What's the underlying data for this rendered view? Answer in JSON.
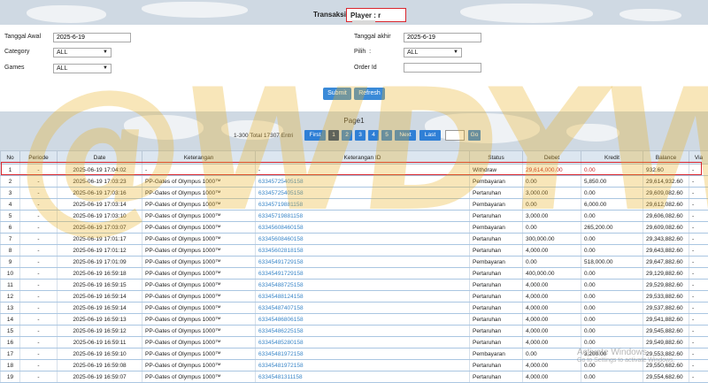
{
  "header": {
    "title": "Transaksi",
    "player_label": "Player : r"
  },
  "form": {
    "tanggal_awal_label": "Tanggal Awal",
    "tanggal_awal_value": "2025-6-19",
    "tanggal_akhir_label": "Tanggal akhir",
    "tanggal_akhir_value": "2025-6-19",
    "category_label": "Category",
    "category_value": "ALL",
    "pilih_label": "Pilih",
    "pilih_colon": ":",
    "pilih_value": "ALL",
    "games_label": "Games",
    "games_value": "ALL",
    "order_id_label": "Order Id",
    "order_id_value": "",
    "submit_label": "Submit",
    "refresh_label": "Refresh"
  },
  "pager": {
    "page_title": "Page1",
    "info": "1-300 Total 17307 Entri",
    "first_label": "First",
    "pages": [
      "1",
      "2",
      "3",
      "4",
      "5"
    ],
    "active_page": "1",
    "next_label": "Next",
    "last_label": "Last",
    "go_label": "Go"
  },
  "table": {
    "columns": [
      "No",
      "Periode",
      "Date",
      "Keterangan",
      "Keterangan ID",
      "Status",
      "Debet",
      "Kredit",
      "Balance",
      "Via"
    ],
    "rows": [
      [
        "1",
        "-",
        "2025-06-19 17:04:02",
        "-",
        "-",
        "Withdraw",
        "29,614,000.00",
        "0.00",
        "932.60",
        "-"
      ],
      [
        "2",
        "-",
        "2025-06-19 17:03:23",
        "PP-Gates of Olympus 1000™",
        "63345725405158",
        "Pembayaran",
        "0.00",
        "5,850.00",
        "29,614,932.60",
        "-"
      ],
      [
        "3",
        "-",
        "2025-06-19 17:03:16",
        "PP-Gates of Olympus 1000™",
        "63345725405158",
        "Pertaruhan",
        "3,000.00",
        "0.00",
        "29,609,082.60",
        "-"
      ],
      [
        "4",
        "-",
        "2025-06-19 17:03:14",
        "PP-Gates of Olympus 1000™",
        "63345719881158",
        "Pembayaran",
        "0.00",
        "6,000.00",
        "29,612,082.60",
        "-"
      ],
      [
        "5",
        "-",
        "2025-06-19 17:03:10",
        "PP-Gates of Olympus 1000™",
        "63345719881158",
        "Pertaruhan",
        "3,000.00",
        "0.00",
        "29,606,082.60",
        "-"
      ],
      [
        "6",
        "-",
        "2025-06-19 17:03:07",
        "PP-Gates of Olympus 1000™",
        "63345608460158",
        "Pembayaran",
        "0.00",
        "265,200.00",
        "29,609,082.60",
        "-"
      ],
      [
        "7",
        "-",
        "2025-06-19 17:01:17",
        "PP-Gates of Olympus 1000™",
        "63345608460158",
        "Pertaruhan",
        "300,000.00",
        "0.00",
        "29,343,882.60",
        "-"
      ],
      [
        "8",
        "-",
        "2025-06-19 17:01:12",
        "PP-Gates of Olympus 1000™",
        "63345602818158",
        "Pertaruhan",
        "4,000.00",
        "0.00",
        "29,643,882.60",
        "-"
      ],
      [
        "9",
        "-",
        "2025-06-19 17:01:09",
        "PP-Gates of Olympus 1000™",
        "63345491729158",
        "Pembayaran",
        "0.00",
        "518,000.00",
        "29,647,882.60",
        "-"
      ],
      [
        "10",
        "-",
        "2025-06-19 16:59:18",
        "PP-Gates of Olympus 1000™",
        "63345491729158",
        "Pertaruhan",
        "400,000.00",
        "0.00",
        "29,129,882.60",
        "-"
      ],
      [
        "11",
        "-",
        "2025-06-19 16:59:15",
        "PP-Gates of Olympus 1000™",
        "63345488725158",
        "Pertaruhan",
        "4,000.00",
        "0.00",
        "29,529,882.60",
        "-"
      ],
      [
        "12",
        "-",
        "2025-06-19 16:59:14",
        "PP-Gates of Olympus 1000™",
        "63345488124158",
        "Pertaruhan",
        "4,000.00",
        "0.00",
        "29,533,882.60",
        "-"
      ],
      [
        "13",
        "-",
        "2025-06-19 16:59:14",
        "PP-Gates of Olympus 1000™",
        "63345487407158",
        "Pertaruhan",
        "4,000.00",
        "0.00",
        "29,537,882.60",
        "-"
      ],
      [
        "14",
        "-",
        "2025-06-19 16:59:13",
        "PP-Gates of Olympus 1000™",
        "63345486806158",
        "Pertaruhan",
        "4,000.00",
        "0.00",
        "29,541,882.60",
        "-"
      ],
      [
        "15",
        "-",
        "2025-06-19 16:59:12",
        "PP-Gates of Olympus 1000™",
        "63345486225158",
        "Pertaruhan",
        "4,000.00",
        "0.00",
        "29,545,882.60",
        "-"
      ],
      [
        "16",
        "-",
        "2025-06-19 16:59:11",
        "PP-Gates of Olympus 1000™",
        "63345485280158",
        "Pertaruhan",
        "4,000.00",
        "0.00",
        "29,549,882.60",
        "-"
      ],
      [
        "17",
        "-",
        "2025-06-19 16:59:10",
        "PP-Gates of Olympus 1000™",
        "63345481972158",
        "Pembayaran",
        "0.00",
        "3,200.00",
        "29,553,882.60",
        "-"
      ],
      [
        "18",
        "-",
        "2025-06-19 16:59:08",
        "PP-Gates of Olympus 1000™",
        "63345481972158",
        "Pertaruhan",
        "4,000.00",
        "0.00",
        "29,550,682.60",
        "-"
      ],
      [
        "19",
        "-",
        "2025-06-19 16:59:07",
        "PP-Gates of Olympus 1000™",
        "63345481311158",
        "Pertaruhan",
        "4,000.00",
        "0.00",
        "29,554,682.60",
        "-"
      ]
    ]
  },
  "overlay": {
    "watermark": "@WDYWK",
    "activate_title": "Activate Windows",
    "activate_sub": "Go to Settings to activate Windows."
  },
  "colors": {
    "accent": "#3a8ad8",
    "highlight_border": "#d9262e",
    "link": "#3a86c8"
  }
}
